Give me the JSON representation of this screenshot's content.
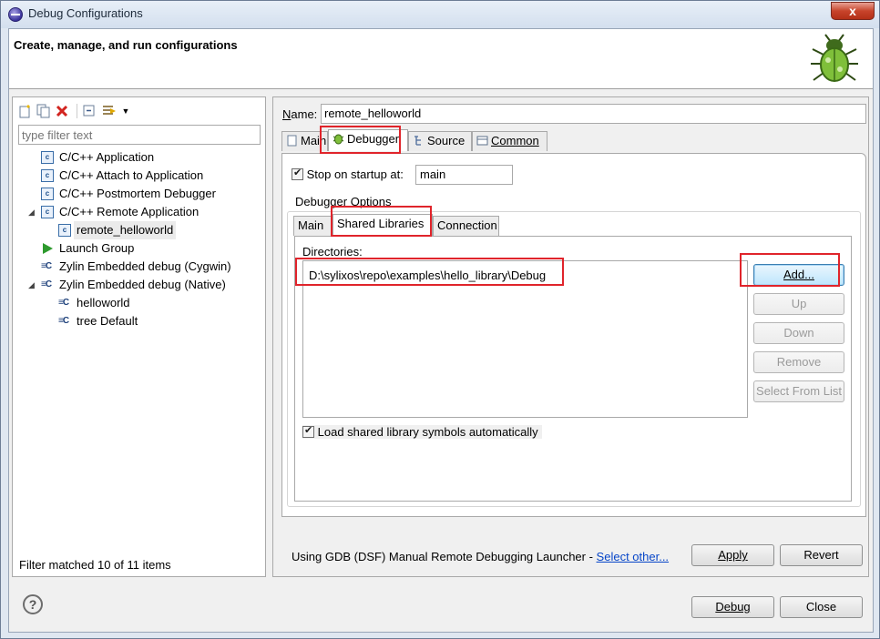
{
  "window": {
    "title": "Debug Configurations",
    "close_glyph": "x"
  },
  "header": {
    "title": "Create, manage, and run configurations",
    "icon": "bug-icon"
  },
  "left": {
    "filter_placeholder": "type filter text",
    "toolbar_icons": [
      "new-config-icon",
      "duplicate-icon",
      "delete-icon",
      "collapse-all-icon",
      "filter-icon",
      "dropdown-arrow-icon"
    ],
    "tree": [
      {
        "label": "C/C++ Application",
        "icon": "c-file-icon",
        "expander": ""
      },
      {
        "label": "C/C++ Attach to Application",
        "icon": "c-file-icon",
        "expander": ""
      },
      {
        "label": "C/C++ Postmortem Debugger",
        "icon": "c-file-icon",
        "expander": ""
      },
      {
        "label": "C/C++ Remote Application",
        "icon": "c-file-icon",
        "expander": "◢"
      },
      {
        "label": "remote_helloworld",
        "icon": "c-file-icon",
        "expander": ""
      },
      {
        "label": "Launch Group",
        "icon": "launch-group-icon",
        "expander": ""
      },
      {
        "label": "Zylin Embedded debug (Cygwin)",
        "icon": "zylin-icon",
        "expander": ""
      },
      {
        "label": "Zylin Embedded debug (Native)",
        "icon": "zylin-icon",
        "expander": "◢"
      },
      {
        "label": "helloworld",
        "icon": "zylin-icon",
        "expander": ""
      },
      {
        "label": "tree Default",
        "icon": "zylin-icon",
        "expander": ""
      }
    ],
    "filter_status": "Filter matched 10 of 11 items"
  },
  "right": {
    "name_label_prefix": "N",
    "name_label_rest": "ame:",
    "name_value": "remote_helloworld",
    "tabs": [
      {
        "label": "Main"
      },
      {
        "label": "Debugger"
      },
      {
        "label": "Source"
      },
      {
        "label": "Common"
      }
    ],
    "stop_on_startup_label": "Stop on startup at:",
    "stop_on_startup_value": "main",
    "debugger_options_label": "Debugger Options",
    "subtabs": [
      {
        "label": "Main"
      },
      {
        "label": "Shared Libraries"
      },
      {
        "label": "Connection"
      }
    ],
    "directories_label": "Directories:",
    "directories": [
      "D:\\sylixos\\repo\\examples\\hello_library\\Debug"
    ],
    "buttons": {
      "add": "Add...",
      "up": "Up",
      "down": "Down",
      "remove": "Remove",
      "select_from_list": "Select From List"
    },
    "load_symbols_label": "Load shared library symbols automatically",
    "launcher_text": "Using GDB (DSF) Manual Remote Debugging Launcher - ",
    "select_other": "Select other...",
    "apply": "Apply",
    "revert": "Revert"
  },
  "footer": {
    "debug": "Debug",
    "close": "Close",
    "help_glyph": "?"
  },
  "colors": {
    "annotation_red": "#e0242b",
    "link_blue": "#0645c8"
  }
}
